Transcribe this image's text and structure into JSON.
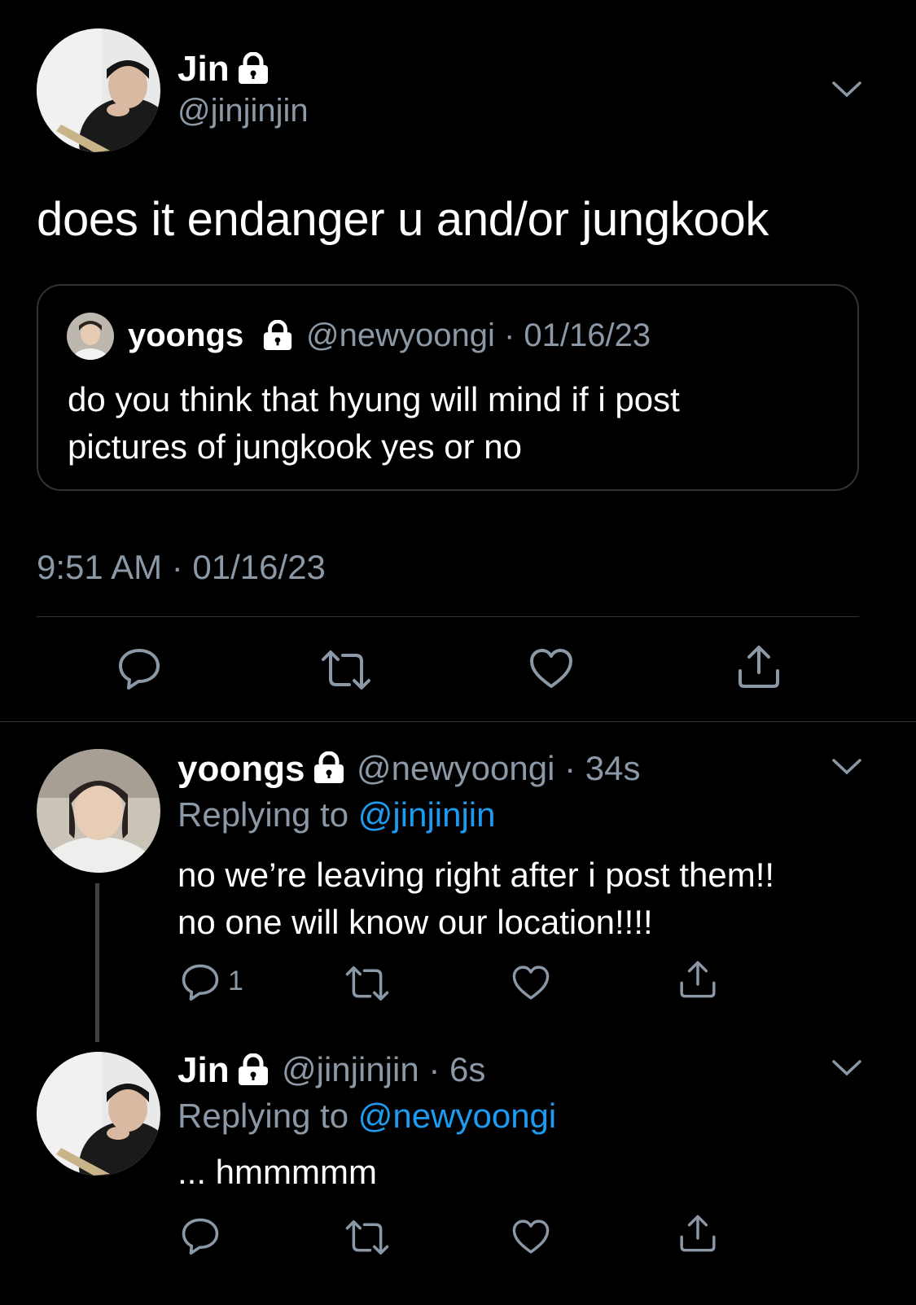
{
  "main_tweet": {
    "name": "Jin",
    "handle": "@jinjinjin",
    "text": "does it endanger u and/or jungkook",
    "timestamp": "9:51 AM · 01/16/23",
    "quoted": {
      "name": "yoongs",
      "handle": "@newyoongi",
      "date": "· 01/16/23",
      "text_line1": "do you think that hyung will mind if i post",
      "text_line2": "pictures of jungkook yes or no"
    }
  },
  "replies": [
    {
      "name": "yoongs",
      "handle": "@newyoongi",
      "time": "· 34s",
      "replying_prefix": "Replying to ",
      "replying_to": "@jinjinjin",
      "text_line1": "no we’re leaving right after i post them!!",
      "text_line2": "no one will know our location!!!!",
      "reply_count": "1"
    },
    {
      "name": "Jin",
      "handle": "@jinjinjin",
      "time": "· 6s",
      "replying_prefix": "Replying to ",
      "replying_to": "@newyoongi",
      "text_line1": "... hmmmmm"
    }
  ],
  "icons": [
    "lock-icon",
    "chevron-down-icon",
    "reply-icon",
    "retweet-icon",
    "like-icon",
    "share-icon"
  ],
  "colors": {
    "background": "#000000",
    "text": "#ffffff",
    "muted": "#8b98a5",
    "link": "#1d9bf0",
    "border": "#2f3336"
  }
}
